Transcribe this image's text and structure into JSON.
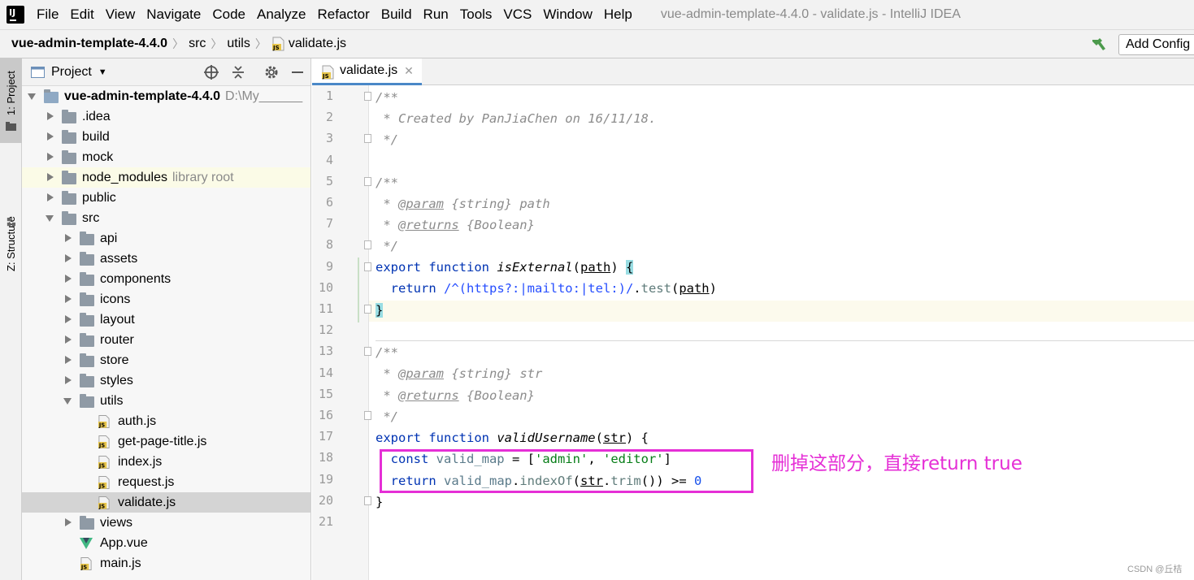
{
  "menubar": {
    "items": [
      "File",
      "Edit",
      "View",
      "Navigate",
      "Code",
      "Analyze",
      "Refactor",
      "Build",
      "Run",
      "Tools",
      "VCS",
      "Window",
      "Help"
    ],
    "window_title": "vue-admin-template-4.4.0 - validate.js - IntelliJ IDEA"
  },
  "navbar": {
    "crumbs": [
      "vue-admin-template-4.4.0",
      "src",
      "utils",
      "validate.js"
    ],
    "add_config_label": "Add Config"
  },
  "toolstrip": {
    "project_label": "1: Project",
    "structure_label": "Z: Structure"
  },
  "project_panel": {
    "title": "Project",
    "tree": [
      {
        "label": "vue-admin-template-4.4.0",
        "hint": "D:\\My______",
        "type": "root"
      },
      {
        "label": ".idea",
        "type": "folder"
      },
      {
        "label": "build",
        "type": "folder"
      },
      {
        "label": "mock",
        "type": "folder"
      },
      {
        "label": "node_modules",
        "hint": "library root",
        "type": "folder"
      },
      {
        "label": "public",
        "type": "folder"
      },
      {
        "label": "src",
        "type": "folder"
      },
      {
        "label": "api",
        "type": "folder"
      },
      {
        "label": "assets",
        "type": "folder"
      },
      {
        "label": "components",
        "type": "folder"
      },
      {
        "label": "icons",
        "type": "folder"
      },
      {
        "label": "layout",
        "type": "folder"
      },
      {
        "label": "router",
        "type": "folder"
      },
      {
        "label": "store",
        "type": "folder"
      },
      {
        "label": "styles",
        "type": "folder"
      },
      {
        "label": "utils",
        "type": "folder"
      },
      {
        "label": "auth.js",
        "type": "js"
      },
      {
        "label": "get-page-title.js",
        "type": "js"
      },
      {
        "label": "index.js",
        "type": "js"
      },
      {
        "label": "request.js",
        "type": "js"
      },
      {
        "label": "validate.js",
        "type": "js"
      },
      {
        "label": "views",
        "type": "folder"
      },
      {
        "label": "App.vue",
        "type": "vue"
      },
      {
        "label": "main.js",
        "type": "js"
      }
    ]
  },
  "editor": {
    "tab_label": "validate.js",
    "line_numbers": [
      "1",
      "2",
      "3",
      "4",
      "5",
      "6",
      "7",
      "8",
      "9",
      "10",
      "11",
      "12",
      "13",
      "14",
      "15",
      "16",
      "17",
      "18",
      "19",
      "20",
      "21"
    ],
    "code": {
      "l1": "/**",
      "l2": " * Created by PanJiaChen on 16/11/18.",
      "l3": " */",
      "l5": "/**",
      "l6_star": " * ",
      "l6_tag": "@param",
      "l6_rest": " {string} path",
      "l7_star": " * ",
      "l7_tag": "@returns",
      "l7_rest": " {Boolean}",
      "l8": " */",
      "l9_kw": "export function ",
      "l9_fn": "isExternal",
      "l9_open": "(",
      "l9_param": "path",
      "l9_close": ") ",
      "l9_brace": "{",
      "l10_kw": "  return ",
      "l10_regex": "/^(https?:|mailto:|tel:)/",
      "l10_dot": ".",
      "l10_method": "test",
      "l10_open": "(",
      "l10_param": "path",
      "l10_close": ")",
      "l11_brace": "}",
      "l13": "/**",
      "l14_star": " * ",
      "l14_tag": "@param",
      "l14_rest": " {string} str",
      "l15_star": " * ",
      "l15_tag": "@returns",
      "l15_rest": " {Boolean}",
      "l16": " */",
      "l17_kw": "export function ",
      "l17_fn": "validUsername",
      "l17_open": "(",
      "l17_param": "str",
      "l17_close": ") {",
      "l18_kw": "  const ",
      "l18_var": "valid_map",
      "l18_eq": " = [",
      "l18_s1": "'admin'",
      "l18_comma": ", ",
      "l18_s2": "'editor'",
      "l18_end": "]",
      "l19_kw": "  return ",
      "l19_var": "valid_map",
      "l19_dot": ".",
      "l19_method": "indexOf",
      "l19_open": "(",
      "l19_param": "str",
      "l19_dot2": ".",
      "l19_method2": "trim",
      "l19_close": "()) >= ",
      "l19_num": "0",
      "l20": "}"
    }
  },
  "annotation": {
    "text": "删掉这部分，直接return true",
    "color": "#e52fd6"
  },
  "watermark": "CSDN @丘桔"
}
